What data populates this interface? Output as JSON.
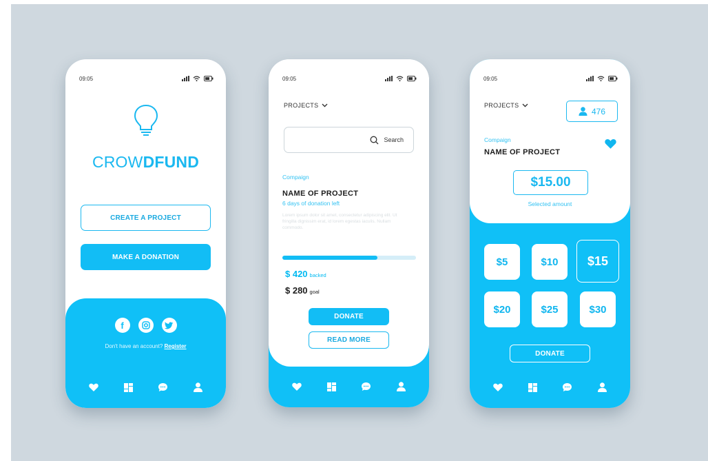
{
  "colors": {
    "accent": "#10c0f7",
    "text": "#1d1d1d",
    "background": "#cfd8df"
  },
  "screen1": {
    "time": "09:05",
    "logo_regular": "CROW",
    "logo_bold": "DFUND",
    "create_button": "CREATE A PROJECT",
    "donate_button": "MAKE A DONATION",
    "account_prompt": "Don't have an account?",
    "register_link": "Register",
    "social_icons": [
      "facebook-icon",
      "instagram-icon",
      "twitter-icon"
    ],
    "nav_icons": [
      "heart-icon",
      "grid-icon",
      "chat-icon",
      "user-icon"
    ]
  },
  "screen2": {
    "time": "09:05",
    "dropdown": "PROJECTS",
    "search_placeholder": "Search",
    "campaign_label": "Compaign",
    "project_name": "NAME OF PROJECT",
    "days_left": "6 days of donation left",
    "description": "Lorem ipsum dolor sit amet, consectetur adipiscing elit. Ut fringilla dignissim erat, id lorem egestas iaculis. Nullam commodo.",
    "progress": 0.71,
    "backed_amount": "$ 420",
    "backed_label": "backed",
    "goal_amount": "$ 280",
    "goal_label": "goal",
    "donate_button": "DONATE",
    "read_more_button": "READ MORE"
  },
  "screen3": {
    "time": "09:05",
    "dropdown": "PROJECTS",
    "backers_count": "476",
    "campaign_label": "Compaign",
    "project_name": "NAME OF PROJECT",
    "selected_amount": "$15.00",
    "selected_label": "Selected amount",
    "amounts": [
      "$5",
      "$10",
      "$15",
      "$20",
      "$25",
      "$30"
    ],
    "selected_index": 2,
    "donate_button": "DONATE"
  }
}
